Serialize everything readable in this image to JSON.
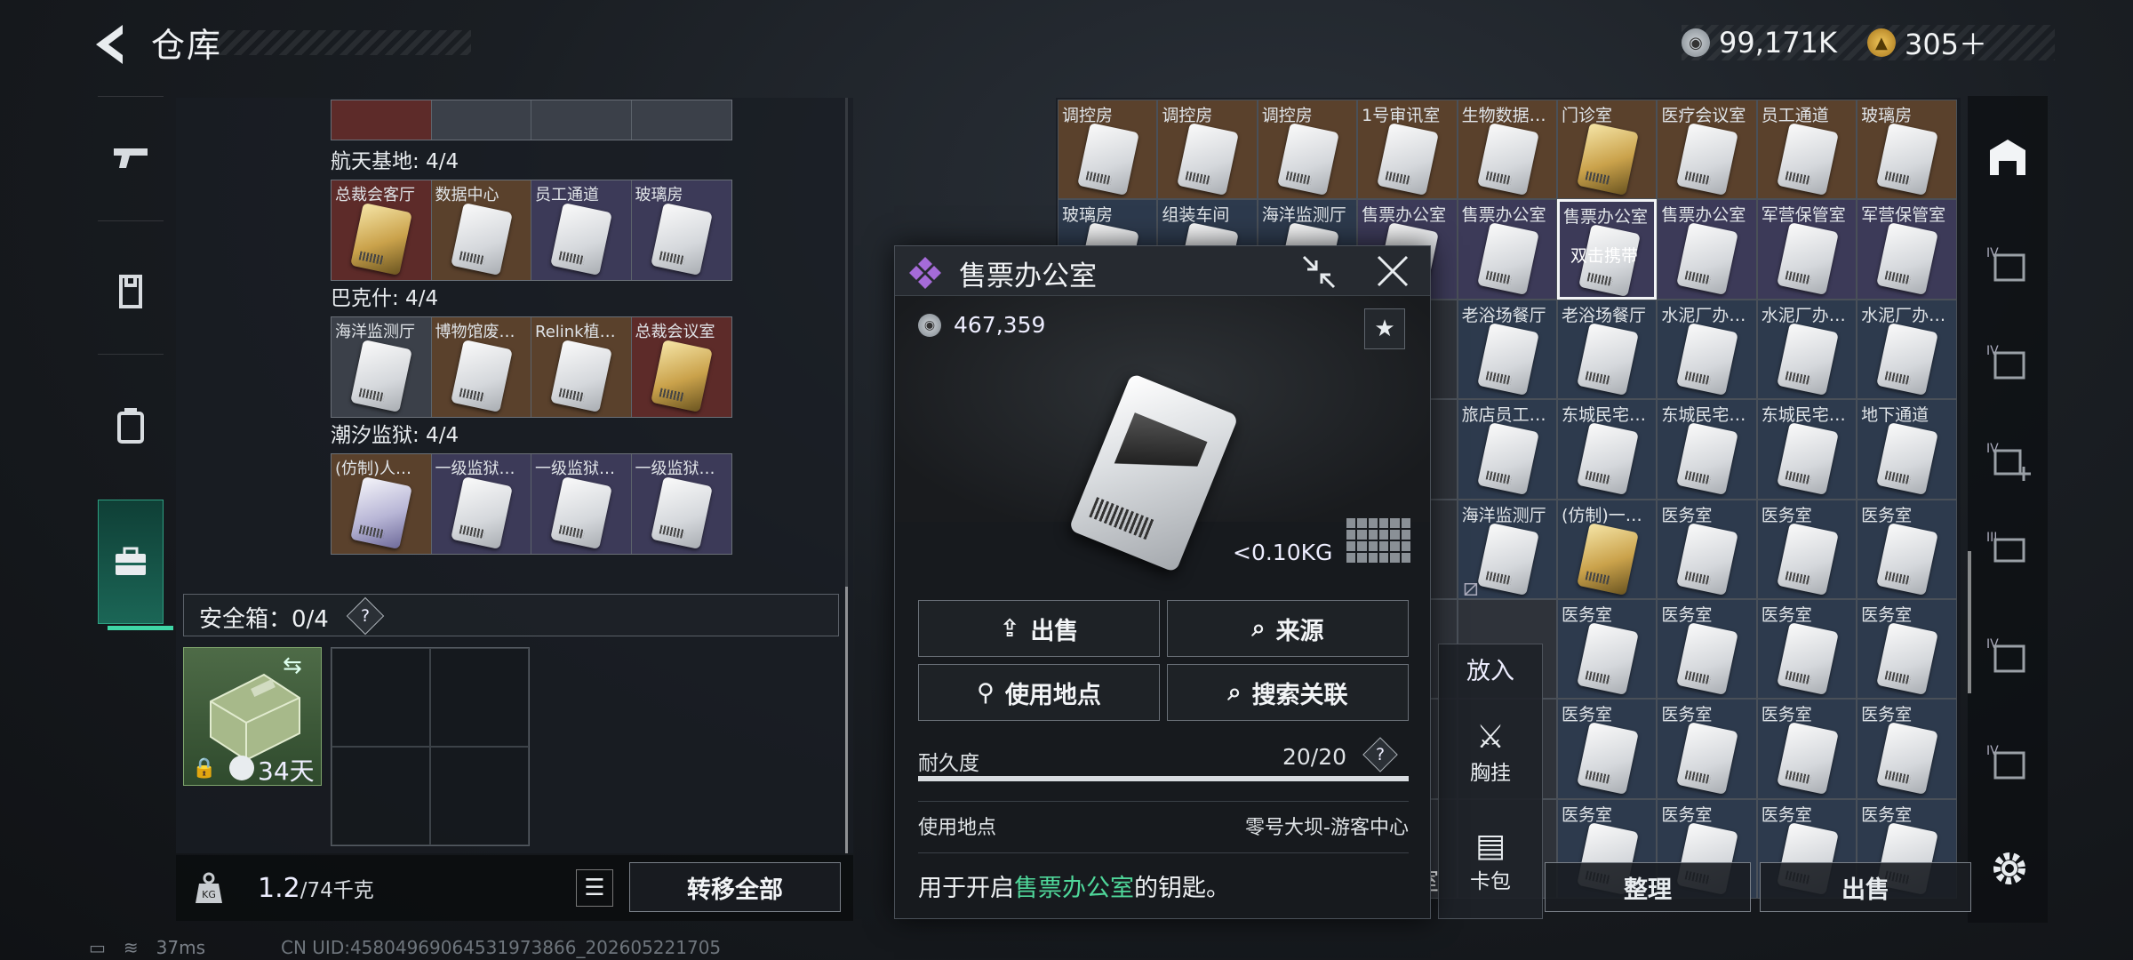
{
  "header": {
    "title": "仓库",
    "silver": "99,171K",
    "gold": "305＋"
  },
  "left_groups": [
    {
      "title": "航天基地: 4/4",
      "items": [
        {
          "label": "总裁会客厅",
          "bg": "red",
          "card": "gold"
        },
        {
          "label": "数据中心",
          "bg": "brown",
          "card": "white"
        },
        {
          "label": "员工通道",
          "bg": "purple",
          "card": "white"
        },
        {
          "label": "玻璃房",
          "bg": "purple",
          "card": "white"
        }
      ]
    },
    {
      "title": "巴克什: 4/4",
      "items": [
        {
          "label": "海洋监测厅",
          "bg": "gray",
          "card": "white"
        },
        {
          "label": "博物馆废…",
          "bg": "brown",
          "card": "white"
        },
        {
          "label": "Relink植…",
          "bg": "brown",
          "card": "white"
        },
        {
          "label": "总裁会议室",
          "bg": "red",
          "card": "gold"
        }
      ]
    },
    {
      "title": "潮汐监狱: 4/4",
      "items": [
        {
          "label": "(仿制)人…",
          "bg": "brown",
          "card": "purple"
        },
        {
          "label": "一级监狱…",
          "bg": "purple",
          "card": "white"
        },
        {
          "label": "一级监狱…",
          "bg": "purple",
          "card": "white"
        },
        {
          "label": "一级监狱…",
          "bg": "purple",
          "card": "white"
        }
      ]
    }
  ],
  "safebox": {
    "label": "安全箱：0/4",
    "help": "?",
    "days": "34天"
  },
  "weight": {
    "current": "1.2",
    "capacity": "/74千克"
  },
  "buttons": {
    "transfer_all": "转移全部",
    "sort": "整理",
    "sell": "出售",
    "left_partial": "室"
  },
  "status": {
    "ping": "37ms",
    "uid": "CN UID:45804969064531973866_202605221705"
  },
  "storage_rows": [
    [
      "调控房",
      "调控房",
      "调控房",
      "1号审讯室",
      "生物数据…",
      "门诊室",
      "医疗会议室",
      "员工通道",
      "玻璃房"
    ],
    [
      "玻璃房",
      "组装车间",
      "海洋监测厅",
      "售票办公室",
      "售票办公室",
      "售票办公室",
      "售票办公室",
      "军营保管室",
      "军营保管室"
    ],
    [
      "",
      "",
      "",
      "",
      "老浴场餐厅",
      "老浴场餐厅",
      "水泥厂办…",
      "水泥厂办…",
      "水泥厂办…"
    ],
    [
      "",
      "",
      "",
      "",
      "旅店员工…",
      "东城民宅…",
      "东城民宅…",
      "东城民宅…",
      "地下通道"
    ],
    [
      "",
      "",
      "",
      "",
      "海洋监测厅",
      "(仿制)一…",
      "医务室",
      "医务室",
      "医务室"
    ],
    [
      "",
      "",
      "",
      "",
      "",
      "医务室",
      "医务室",
      "医务室",
      "医务室"
    ],
    [
      "",
      "",
      "",
      "",
      "",
      "医务室",
      "医务室",
      "医务室",
      "医务室"
    ],
    [
      "",
      "",
      "",
      "",
      "",
      "医务室",
      "医务室",
      "医务室",
      "医务室"
    ]
  ],
  "storage_selected_hint": "双击携带",
  "putin": {
    "title": "放入",
    "chest": "胸挂",
    "cardbag": "卡包"
  },
  "modal": {
    "title": "售票办公室",
    "price": "467,359",
    "weight": "<0.10KG",
    "btn_sell": "出售",
    "btn_source": "来源",
    "btn_use": "使用地点",
    "btn_search": "搜索关联",
    "durability_label": "耐久度",
    "durability": "20/20",
    "durability_fraction": 1.0,
    "loc_label": "使用地点",
    "loc_value": "零号大坝-游客中心",
    "desc_pre": "用于开启",
    "desc_hl": "售票办公室",
    "desc_post": "的钥匙。"
  },
  "colors": {
    "accent": "#3fd6a6",
    "highlight": "#4fd79a"
  }
}
